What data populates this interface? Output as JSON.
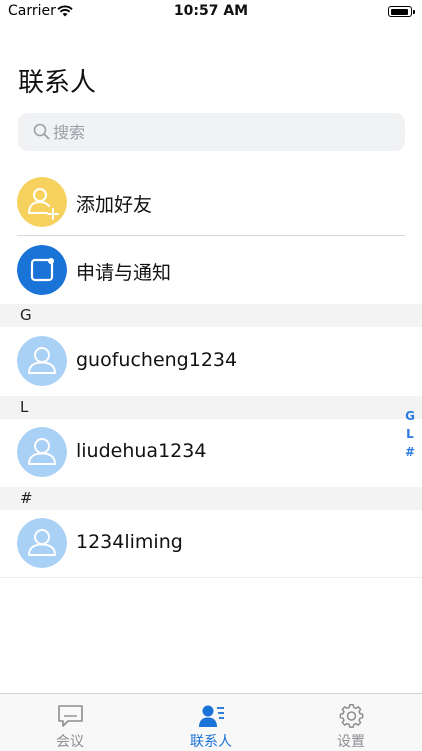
{
  "status_bar": {
    "carrier": "Carrier",
    "time": "10:57 AM"
  },
  "page_title": "联系人",
  "search": {
    "placeholder": "搜索",
    "value": ""
  },
  "actions": [
    {
      "label": "添加好友",
      "icon": "add-friend-icon",
      "color": "#f7d15e"
    },
    {
      "label": "申请与通知",
      "icon": "notification-icon",
      "color": "#1a73d6"
    }
  ],
  "sections": [
    {
      "letter": "G",
      "contacts": [
        {
          "name": "guofucheng1234"
        }
      ]
    },
    {
      "letter": "L",
      "contacts": [
        {
          "name": "liudehua1234"
        }
      ]
    },
    {
      "letter": "#",
      "contacts": [
        {
          "name": "1234liming"
        }
      ]
    }
  ],
  "index_bar": [
    "G",
    "L",
    "#"
  ],
  "tabs": [
    {
      "label": "会议",
      "icon": "chat-bubble-icon",
      "active": false
    },
    {
      "label": "联系人",
      "icon": "contacts-icon",
      "active": true
    },
    {
      "label": "设置",
      "icon": "gear-icon",
      "active": false
    }
  ],
  "colors": {
    "accent": "#1a73d6",
    "avatar_bg": "#a9d0f5",
    "inactive_tab": "#8e8e93"
  }
}
